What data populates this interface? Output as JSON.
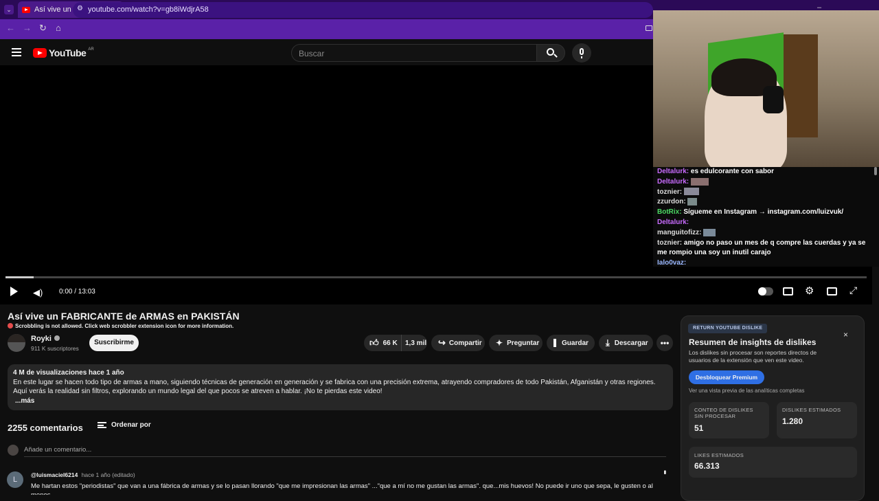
{
  "browser": {
    "tab_title": "Así vive un FABRICANTE de ARMAS en PAKISTÁN",
    "url": "youtube.com/watch?v=gb8iWdjrA58"
  },
  "yt": {
    "logo_text": "YouTube",
    "region": "AR",
    "search_placeholder": "Buscar"
  },
  "player": {
    "time": "0:00 / 13:03",
    "progress_fraction": 0.033
  },
  "chat": {
    "messages": [
      {
        "user": "Deltalurk:",
        "text": " es edulcorante con sabor"
      },
      {
        "user": "Deltalurk:",
        "text": ""
      },
      {
        "user": "toznier:",
        "text": ""
      },
      {
        "user": "zzurdon:",
        "text": ""
      },
      {
        "user": "BotRix:",
        "text": " Sígueme en Instagram → instagram.com/luizvuk/"
      },
      {
        "user": "Deltalurk:",
        "text": ""
      },
      {
        "user": "manguitofizz:",
        "text": ""
      },
      {
        "user": "toznier:",
        "text": " amigo no paso un mes de q compre las cuerdas y ya se me rompio una soy un inutil carajo"
      },
      {
        "user": "Ialo0vaz:",
        "text": ""
      }
    ]
  },
  "video": {
    "title": "Así vive un FABRICANTE de ARMAS en PAKISTÁN",
    "scrobble_notice": "Scrobbling is not allowed. Click web scrobbler extension icon for more information.",
    "channel": "Royki",
    "subscribers": "911 K suscriptores",
    "subscribe_label": "Suscribirme",
    "likes": "66 K",
    "dislikes": "1,3 mil",
    "share_label": "Compartir",
    "ask_label": "Preguntar",
    "save_label": "Guardar",
    "download_label": "Descargar"
  },
  "description": {
    "stats": "4 M de visualizaciones  hace 1 año",
    "text": "En este lugar se hacen todo tipo de armas a mano, siguiendo técnicas de generación en generación y se fabrica con una precisión extrema, atrayendo compradores de todo Pakistán, Afganistán y otras regiones. Aquí verás la realidad sin filtros, explorando un mundo legal del que pocos se atreven a hablar. ¡No te pierdas este video!",
    "more": "...más"
  },
  "comments": {
    "count_label": "2255 comentarios",
    "sort_label": "Ordenar por",
    "add_placeholder": "Añade un comentario...",
    "first": {
      "avatar_letter": "L",
      "author": "@luismaciel6214",
      "meta": "hace 1 año (editado)",
      "text": "Me hartan estos \"periodistas\" que van a una fábrica de armas y se lo pasan llorando \"que me impresionan las armas\" ...\"que a mí no me gustan las armas\". que...mis huevos!  No puede ir uno que sepa, le gusten o al menos"
    }
  },
  "dislike_panel": {
    "badge": "RETURN YOUTUBE DISLIKE",
    "heading": "Resumen de insights de dislikes",
    "body": "Los dislikes sin procesar son reportes directos de usuarios de la extensión que ven este video.",
    "cta": "Desbloquear Premium",
    "preview_note": "Ver una vista previa de las analíticas completas",
    "raw_label": "CONTEO DE DISLIKES SIN PROCESAR",
    "raw_value": "51",
    "est_label": "DISLIKES ESTIMADOS",
    "est_value": "1.280",
    "likes_label": "LIKES ESTIMADOS",
    "likes_value": "66.313"
  }
}
